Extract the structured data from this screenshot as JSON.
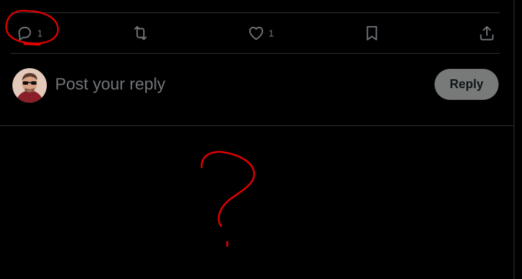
{
  "actions": {
    "reply_count": "1",
    "like_count": "1"
  },
  "composer": {
    "placeholder": "Post your reply",
    "reply_button_label": "Reply"
  },
  "icons": {
    "reply": "speech-bubble-icon",
    "repost": "repost-arrows-icon",
    "like": "heart-icon",
    "bookmark": "bookmark-icon",
    "share": "share-upload-icon"
  },
  "annotations": {
    "circle_target": "reply-count",
    "question_mark": "?"
  },
  "colors": {
    "background": "#000000",
    "muted_text": "#71767b",
    "divider": "#2f3336",
    "reply_button_bg": "#787a7a",
    "annotation_red": "#e00000"
  }
}
